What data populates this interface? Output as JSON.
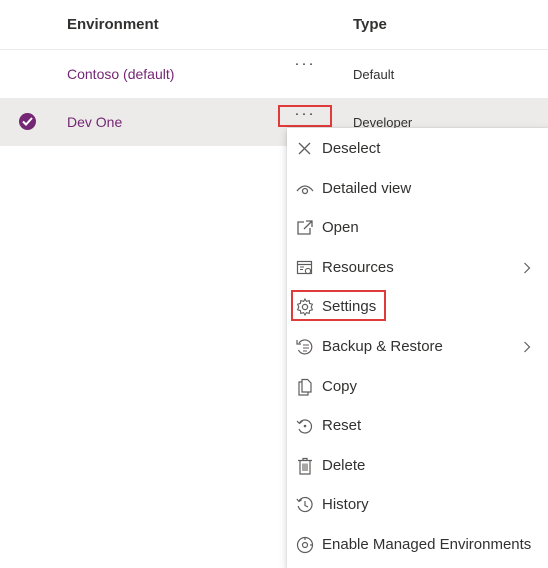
{
  "header": {
    "environment": "Environment",
    "type": "Type"
  },
  "rows": [
    {
      "name": "Contoso (default)",
      "type": "Default",
      "more": "···",
      "selected": false
    },
    {
      "name": "Dev One",
      "type": "Developer",
      "more": "···",
      "selected": true
    }
  ],
  "menu": {
    "items": [
      {
        "label": "Deselect",
        "icon": "close-icon",
        "submenu": false
      },
      {
        "label": "Detailed view",
        "icon": "eye-icon",
        "submenu": false
      },
      {
        "label": "Open",
        "icon": "open-in-new-window-icon",
        "submenu": false
      },
      {
        "label": "Resources",
        "icon": "resources-icon",
        "submenu": true
      },
      {
        "label": "Settings",
        "icon": "gear-icon",
        "submenu": false,
        "highlighted": true
      },
      {
        "label": "Backup & Restore",
        "icon": "backup-restore-icon",
        "submenu": true
      },
      {
        "label": "Copy",
        "icon": "copy-icon",
        "submenu": false
      },
      {
        "label": "Reset",
        "icon": "reset-icon",
        "submenu": false
      },
      {
        "label": "Delete",
        "icon": "trash-icon",
        "submenu": false
      },
      {
        "label": "History",
        "icon": "history-icon",
        "submenu": false
      },
      {
        "label": "Enable Managed Environments",
        "icon": "managed-environment-icon",
        "submenu": false
      }
    ]
  },
  "colors": {
    "accent": "#742774",
    "highlight_border": "#e03b3b",
    "selected_row_bg": "#edebe9",
    "text": "#323130"
  }
}
